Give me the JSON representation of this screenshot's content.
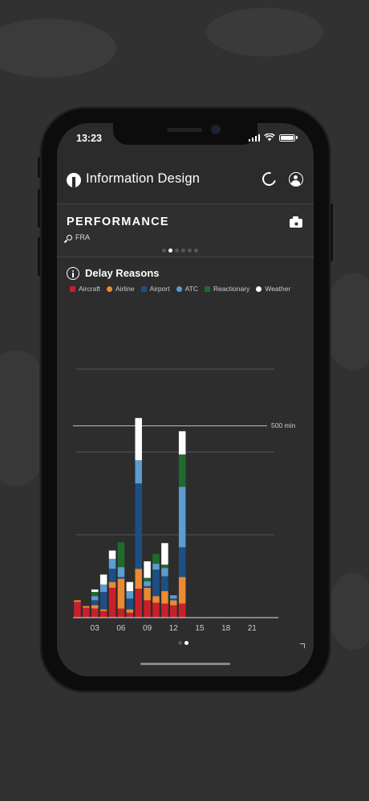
{
  "status": {
    "time": "13:23"
  },
  "header": {
    "title": "Information Design",
    "refresh_icon": "refresh-icon",
    "profile_icon": "profile-icon"
  },
  "performance": {
    "title": "PERFORMANCE",
    "airport": "FRA",
    "pager": {
      "count": 6,
      "active": 1
    }
  },
  "chart_card": {
    "title": "Delay Reasons",
    "scale_label": "500 min",
    "pager": {
      "count": 2,
      "active": 1
    }
  },
  "colors": {
    "Aircraft": "#c8202b",
    "Airline": "#ea8a33",
    "Airport": "#1d4f86",
    "ATC": "#5b9dd0",
    "Reactionary": "#1f6b2e",
    "Weather": "#ffffff"
  },
  "chart_data": {
    "type": "bar",
    "stacked": true,
    "legend": [
      "Aircraft",
      "Airline",
      "Airport",
      "ATC",
      "Reactionary",
      "Weather"
    ],
    "x": [
      1,
      2,
      3,
      4,
      5,
      6,
      7,
      8,
      9,
      10,
      11,
      12,
      13
    ],
    "xticks": [
      "03",
      "06",
      "09",
      "12",
      "15",
      "18",
      "21"
    ],
    "xtick_values": [
      3,
      6,
      9,
      12,
      15,
      18,
      21
    ],
    "xlim": [
      0.5,
      24
    ],
    "ylim": [
      0,
      1500
    ],
    "grid_y": [
      500,
      1000,
      1500
    ],
    "series": [
      {
        "name": "Aircraft",
        "values": [
          95,
          60,
          55,
          40,
          180,
          55,
          30,
          175,
          105,
          90,
          85,
          75,
          85
        ]
      },
      {
        "name": "Airline",
        "values": [
          10,
          10,
          20,
          10,
          35,
          180,
          20,
          120,
          75,
          40,
          75,
          30,
          160
        ]
      },
      {
        "name": "Airport",
        "values": [
          0,
          0,
          30,
          105,
          80,
          10,
          65,
          515,
          10,
          160,
          90,
          10,
          180
        ]
      },
      {
        "name": "ATC",
        "values": [
          0,
          0,
          25,
          45,
          60,
          60,
          45,
          140,
          30,
          35,
          50,
          20,
          365
        ]
      },
      {
        "name": "Reactionary",
        "values": [
          0,
          0,
          25,
          0,
          0,
          150,
          0,
          0,
          20,
          60,
          20,
          0,
          195
        ]
      },
      {
        "name": "Weather",
        "values": [
          0,
          0,
          15,
          60,
          50,
          0,
          55,
          255,
          100,
          0,
          130,
          0,
          140
        ]
      }
    ]
  }
}
